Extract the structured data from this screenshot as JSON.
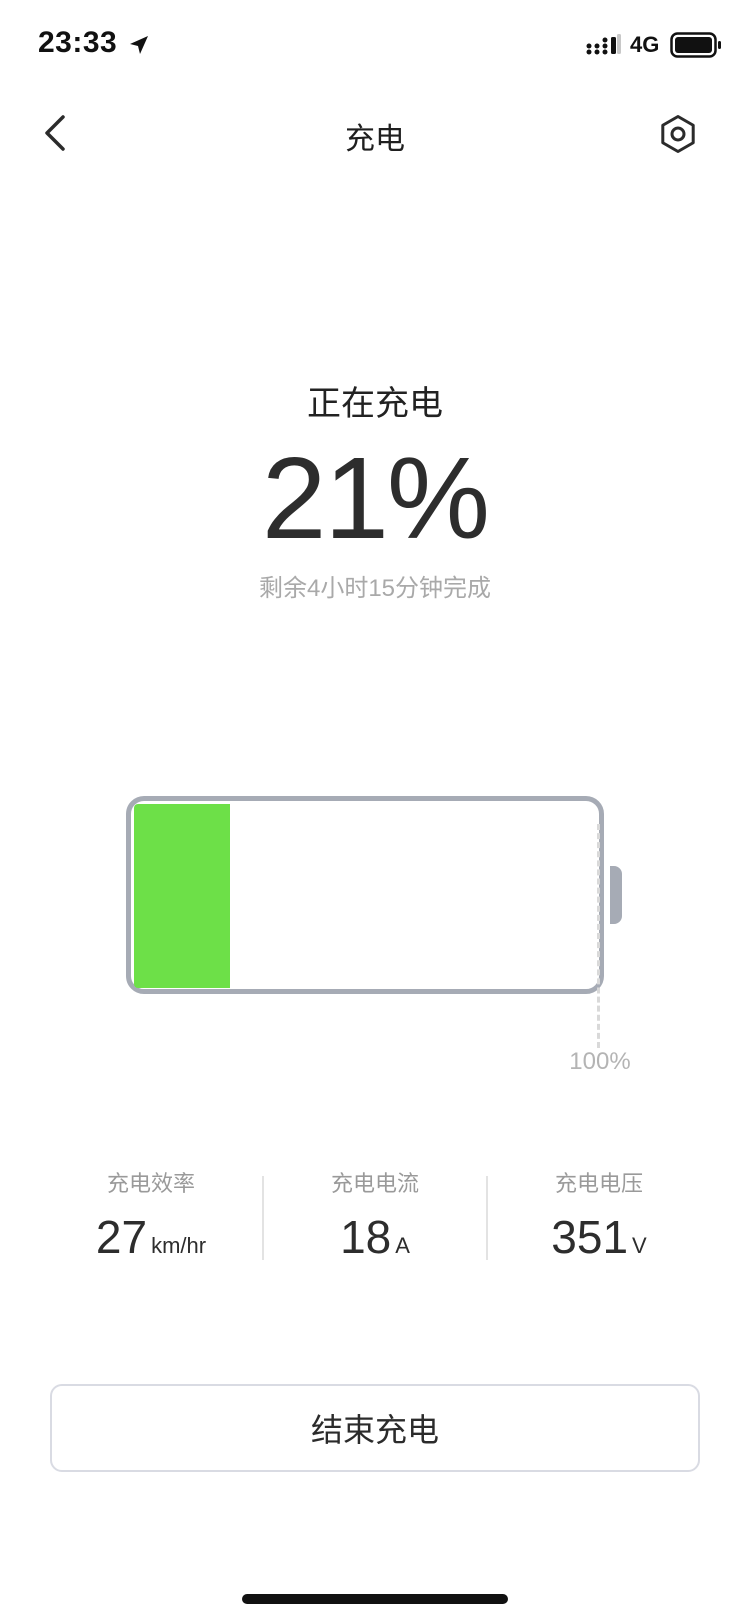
{
  "status_bar": {
    "time": "23:33",
    "network": "4G"
  },
  "nav": {
    "title": "充电"
  },
  "charging": {
    "status": "正在充电",
    "percent_label": "21%",
    "percent_value": 21,
    "remaining": "剩余4小时15分钟完成",
    "full_marker_label": "100%"
  },
  "metrics": [
    {
      "label": "充电效率",
      "value": "27",
      "unit": "km/hr"
    },
    {
      "label": "充电电流",
      "value": "18",
      "unit": "A"
    },
    {
      "label": "充电电压",
      "value": "351",
      "unit": "V"
    }
  ],
  "actions": {
    "stop_label": "结束充电"
  },
  "colors": {
    "battery_fill": "#6de048",
    "battery_outline": "#a6abb5",
    "secondary_text": "#a9a9a9"
  },
  "icons": {
    "back": "chevron-left-icon",
    "settings": "hex-nut-settings-icon",
    "location": "location-arrow-icon",
    "signal": "cell-signal-icon",
    "battery": "battery-icon"
  }
}
